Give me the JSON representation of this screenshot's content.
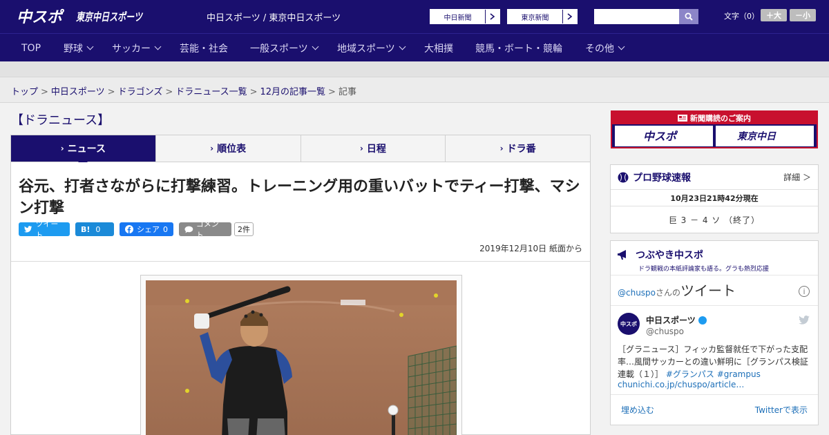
{
  "header": {
    "logo_primary": "中スポ",
    "logo_secondary": "東京中日スポーツ",
    "site_title": "中日スポーツ / 東京中日スポーツ",
    "paper_links": [
      "中日新聞",
      "東京新聞"
    ],
    "search_placeholder": "",
    "font_size_label": "文字（0）",
    "font_up_label": "＋大",
    "font_down_label": "－小"
  },
  "nav": {
    "items": [
      {
        "label": "TOP",
        "has_menu": false
      },
      {
        "label": "野球",
        "has_menu": true
      },
      {
        "label": "サッカー",
        "has_menu": true
      },
      {
        "label": "芸能・社会",
        "has_menu": false
      },
      {
        "label": "一般スポーツ",
        "has_menu": true
      },
      {
        "label": "地域スポーツ",
        "has_menu": true
      },
      {
        "label": "大相撲",
        "has_menu": false
      },
      {
        "label": "競馬・ボート・競輪",
        "has_menu": false
      },
      {
        "label": "その他",
        "has_menu": true
      }
    ]
  },
  "breadcrumb": {
    "items": [
      "トップ",
      "中日スポーツ",
      "ドラゴンズ",
      "ドラニュース一覧",
      "12月の記事一覧"
    ],
    "current": "記事"
  },
  "section_title": "【ドラニュース】",
  "tabs": [
    {
      "label": "ニュース",
      "active": true
    },
    {
      "label": "順位表",
      "active": false
    },
    {
      "label": "日程",
      "active": false
    },
    {
      "label": "ドラ番",
      "active": false
    }
  ],
  "article": {
    "headline": "谷元、打者さながらに打撃練習。トレーニング用の重いバットでティー打撃、マシン打撃",
    "share": {
      "tweet_label": "ツイート",
      "hatena_label": "B!",
      "hatena_count": "0",
      "facebook_label": "シェア",
      "facebook_count": "0",
      "comment_label": "コメント",
      "comment_count": "2件"
    },
    "date": "2019年12月10日 紙面から"
  },
  "sidebar": {
    "subscribe": {
      "title": "新聞購読のご案内",
      "logo_a": "中スポ",
      "logo_b": "東京中日"
    },
    "scores": {
      "title": "プロ野球速報",
      "detail_label": "詳細 ＞",
      "timestamp": "10月23日21時42分現在",
      "games": [
        "巨 3 － 4 ソ （終了）"
      ]
    },
    "tweets": {
      "title": "つぶやき中スポ",
      "subtitle": "ドラ観戦の本紙評論家も語る。グラも熱烈応援",
      "handle_link": "@chuspo",
      "handle_suffix": "さんの",
      "heading_big": "ツイート",
      "account_name": "中日スポーツ",
      "account_handle": "@chuspo",
      "avatar_text": "中スポ",
      "body": "［グラニュース］フィッカ監督就任で下がった支配率…風間サッカーとの違い鮮明に［グランパス検証連載（１）］",
      "tags": "#グランパス #grampus",
      "link": "chunichi.co.jp/chuspo/article…",
      "embed_label": "埋め込む",
      "view_label": "Twitterで表示"
    }
  },
  "colors": {
    "brand_navy": "#1a0f6e",
    "accent_red": "#c8102e",
    "twitter_blue": "#1d9bf0",
    "facebook_blue": "#1877f2"
  }
}
